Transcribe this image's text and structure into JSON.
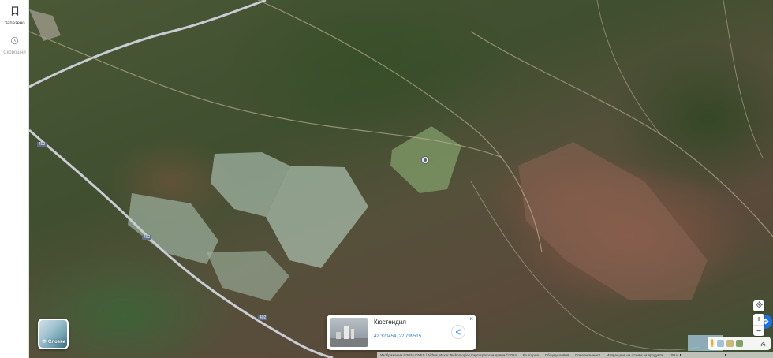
{
  "rail": {
    "saved_label": "Запазено",
    "recent_label": "Скорошни"
  },
  "layers": {
    "label": "Слоеве"
  },
  "map": {
    "road_labels": [
      "402",
      "402",
      "402"
    ]
  },
  "card": {
    "title": "Кюстендил",
    "coords": "42.320454, 22.799515",
    "close": "×"
  },
  "controls": {
    "zoom_in": "+",
    "zoom_out": "−"
  },
  "attribution": {
    "imagery": "Изображения ©2024 CNES / Airbus,Maxar Technologies,Картографски данни ©2024",
    "country": "България",
    "terms": "Общи условия",
    "privacy": "Поверителност",
    "feedback": "Изпращане на отзиви за продукта",
    "scale": "100 м"
  },
  "colors": {
    "accent": "#1a73e8",
    "road": "#c9cdd3"
  }
}
